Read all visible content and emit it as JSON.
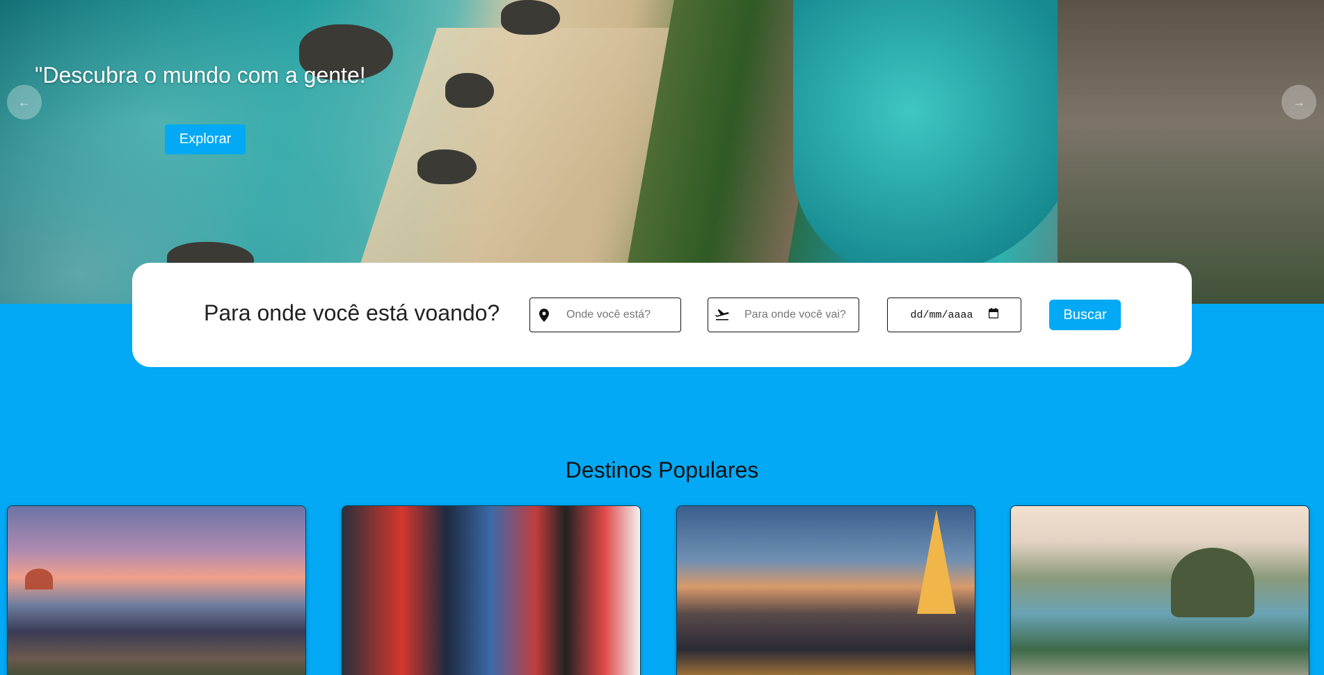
{
  "hero": {
    "title": "\"Descubra o mundo com a gente!",
    "cta_label": "Explorar",
    "prev_arrow": "←",
    "next_arrow": "→"
  },
  "search": {
    "question": "Para onde você está voando?",
    "from_placeholder": "Onde você está?",
    "to_placeholder": "Para onde você vai?",
    "date_placeholder": "dd/mm/aaaa",
    "button_label": "Buscar",
    "icons": {
      "from": "map-marker-icon",
      "to": "airplane-departure-icon",
      "date": "calendar-icon"
    }
  },
  "destinations": {
    "title": "Destinos Populares",
    "cards": [
      {
        "image": "florence-skyline"
      },
      {
        "image": "tokyo-street-night"
      },
      {
        "image": "paris-eiffel-tower"
      },
      {
        "image": "rio-sugarloaf"
      }
    ]
  },
  "colors": {
    "accent": "#03a9f4",
    "card_bg": "#ffffff",
    "text": "#222222"
  }
}
